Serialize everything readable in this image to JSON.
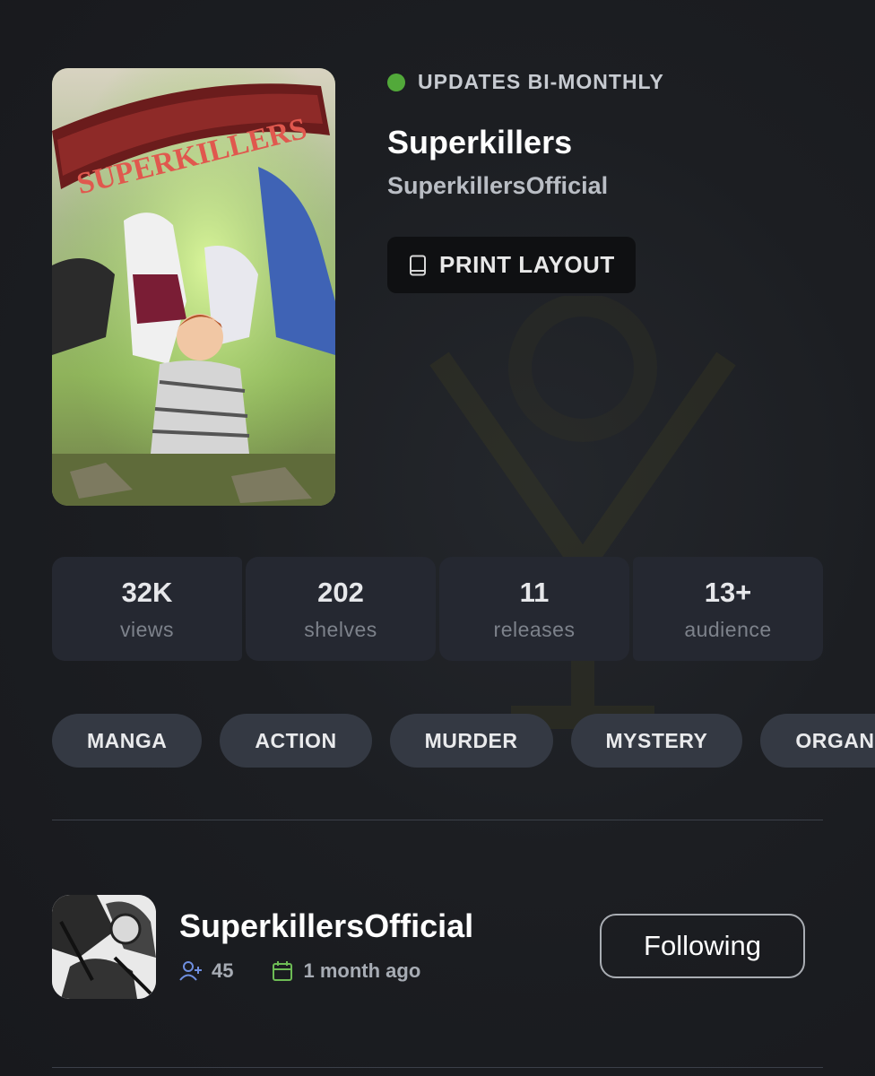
{
  "status": {
    "text": "UPDATES BI-MONTHLY",
    "dot_color": "#52a93a"
  },
  "series": {
    "title": "Superkillers",
    "author": "SuperkillersOfficial",
    "cover_logo": "SUPERKILLERS"
  },
  "actions": {
    "print_layout_label": "PRINT LAYOUT",
    "print_icon": "book-icon"
  },
  "stats": [
    {
      "value": "32K",
      "label": "views"
    },
    {
      "value": "202",
      "label": "shelves"
    },
    {
      "value": "11",
      "label": "releases"
    },
    {
      "value": "13+",
      "label": "audience"
    }
  ],
  "tags": [
    "MANGA",
    "ACTION",
    "MURDER",
    "MYSTERY",
    "ORGANI"
  ],
  "creator": {
    "name": "SuperkillersOfficial",
    "followers": "45",
    "followers_icon": "user-plus-icon",
    "updated": "1 month ago",
    "updated_icon": "calendar-icon",
    "follow_label": "Following"
  },
  "colors": {
    "background": "#1a1c21",
    "card": "#252831",
    "tag": "#343943",
    "accent_green": "#52a93a",
    "icon_blue": "#6f8fe0",
    "icon_green": "#6dbb55"
  }
}
